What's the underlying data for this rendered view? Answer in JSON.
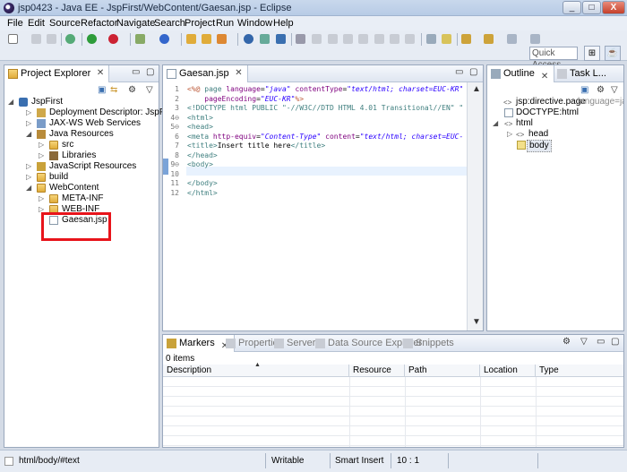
{
  "window": {
    "title": "jsp0423 - Java EE - JspFirst/WebContent/Gaesan.jsp - Eclipse",
    "controls": [
      "_",
      "□",
      "X"
    ]
  },
  "menu": [
    "File",
    "Edit",
    "Source",
    "Refactor",
    "Navigate",
    "Search",
    "Project",
    "Run",
    "Window",
    "Help"
  ],
  "toolbar": {
    "quick_access_placeholder": "Quick Access"
  },
  "project_explorer": {
    "tab_label": "Project Explorer",
    "close": "✕",
    "tree": [
      {
        "label": "JspFirst",
        "twist": "◢",
        "icon": "project-icon"
      },
      {
        "label": "Deployment Descriptor: JspFirst",
        "twist": "▷",
        "icon": "deployment-descriptor-icon"
      },
      {
        "label": "JAX-WS Web Services",
        "twist": "▷",
        "icon": "web-services-icon"
      },
      {
        "label": "Java Resources",
        "twist": "◢",
        "icon": "java-resources-icon"
      },
      {
        "label": "src",
        "twist": "▷",
        "icon": "package-folder-icon"
      },
      {
        "label": "Libraries",
        "twist": "▷",
        "icon": "libraries-icon"
      },
      {
        "label": "JavaScript Resources",
        "twist": "▷",
        "icon": "javascript-resources-icon"
      },
      {
        "label": "build",
        "twist": "▷",
        "icon": "folder-icon"
      },
      {
        "label": "WebContent",
        "twist": "◢",
        "icon": "folder-icon"
      },
      {
        "label": "META-INF",
        "twist": "▷",
        "icon": "folder-icon"
      },
      {
        "label": "WEB-INF",
        "twist": "▷",
        "icon": "folder-icon"
      },
      {
        "label": "Gaesan.jsp",
        "twist": "",
        "icon": "jsp-file-icon"
      }
    ],
    "highlight_color": "#e8141b"
  },
  "editor": {
    "tab_label": "Gaesan.jsp",
    "close": "✕",
    "lines": [
      {
        "n": "1",
        "parts": [
          [
            "c-jsp",
            "<%@ "
          ],
          [
            "c-tag",
            "page "
          ],
          [
            "c-attr",
            "language"
          ],
          [
            "c-txt",
            "="
          ],
          [
            "c-val",
            "\"java\""
          ],
          [
            "c-txt",
            " "
          ],
          [
            "c-attr",
            "contentType"
          ],
          [
            "c-txt",
            "="
          ],
          [
            "c-val",
            "\"text/html; charset=EUC-KR\""
          ]
        ]
      },
      {
        "n": "2",
        "parts": [
          [
            "c-txt",
            "    "
          ],
          [
            "c-attr",
            "pageEncoding"
          ],
          [
            "c-txt",
            "="
          ],
          [
            "c-val",
            "\"EUC-KR\""
          ],
          [
            "c-jsp",
            "%>"
          ]
        ]
      },
      {
        "n": "3",
        "parts": [
          [
            "c-doc",
            "<!DOCTYPE html PUBLIC \"-//W3C//DTD HTML 4.01 Transitional//EN\" \""
          ]
        ]
      },
      {
        "n": "4⊖",
        "parts": [
          [
            "c-tag",
            "<html>"
          ]
        ]
      },
      {
        "n": "5⊖",
        "parts": [
          [
            "c-tag",
            "<head>"
          ]
        ]
      },
      {
        "n": "6",
        "parts": [
          [
            "c-tag",
            "<meta "
          ],
          [
            "c-attr",
            "http-equiv"
          ],
          [
            "c-txt",
            "="
          ],
          [
            "c-val",
            "\"Content-Type\""
          ],
          [
            "c-txt",
            " "
          ],
          [
            "c-attr",
            "content"
          ],
          [
            "c-txt",
            "="
          ],
          [
            "c-val",
            "\"text/html; charset=EUC-"
          ]
        ]
      },
      {
        "n": "7",
        "parts": [
          [
            "c-tag",
            "<title>"
          ],
          [
            "c-txt",
            "Insert title here"
          ],
          [
            "c-tag",
            "</title>"
          ]
        ]
      },
      {
        "n": "8",
        "parts": [
          [
            "c-tag",
            "</head>"
          ]
        ]
      },
      {
        "n": "9⊖",
        "parts": [
          [
            "c-tag",
            "<body>"
          ]
        ]
      },
      {
        "n": "10",
        "parts": []
      },
      {
        "n": "11",
        "parts": [
          [
            "c-tag",
            "</body>"
          ]
        ]
      },
      {
        "n": "12",
        "parts": [
          [
            "c-tag",
            "</html>"
          ]
        ]
      }
    ]
  },
  "outline": {
    "tabs": [
      "Outline",
      "Task L..."
    ],
    "close": "✕",
    "items": [
      {
        "label": "jsp:directive.page",
        "extra": "language=java",
        "twist": "",
        "indent": 0
      },
      {
        "label": "DOCTYPE:html",
        "extra": "",
        "twist": "",
        "indent": 0
      },
      {
        "label": "html",
        "extra": "",
        "twist": "◢",
        "indent": 0
      },
      {
        "label": "head",
        "extra": "",
        "twist": "▷",
        "indent": 1
      },
      {
        "label": "body",
        "extra": "",
        "twist": "",
        "indent": 1
      }
    ]
  },
  "bottom": {
    "tabs": [
      "Markers",
      "Properties",
      "Servers",
      "Data Source Explorer",
      "Snippets"
    ],
    "close": "✕",
    "count": "0 items",
    "columns": [
      "Description",
      "Resource",
      "Path",
      "Location",
      "Type"
    ]
  },
  "status": {
    "path": "html/body/#text",
    "mode": "Writable",
    "insert": "Smart Insert",
    "position": "10 : 1"
  }
}
